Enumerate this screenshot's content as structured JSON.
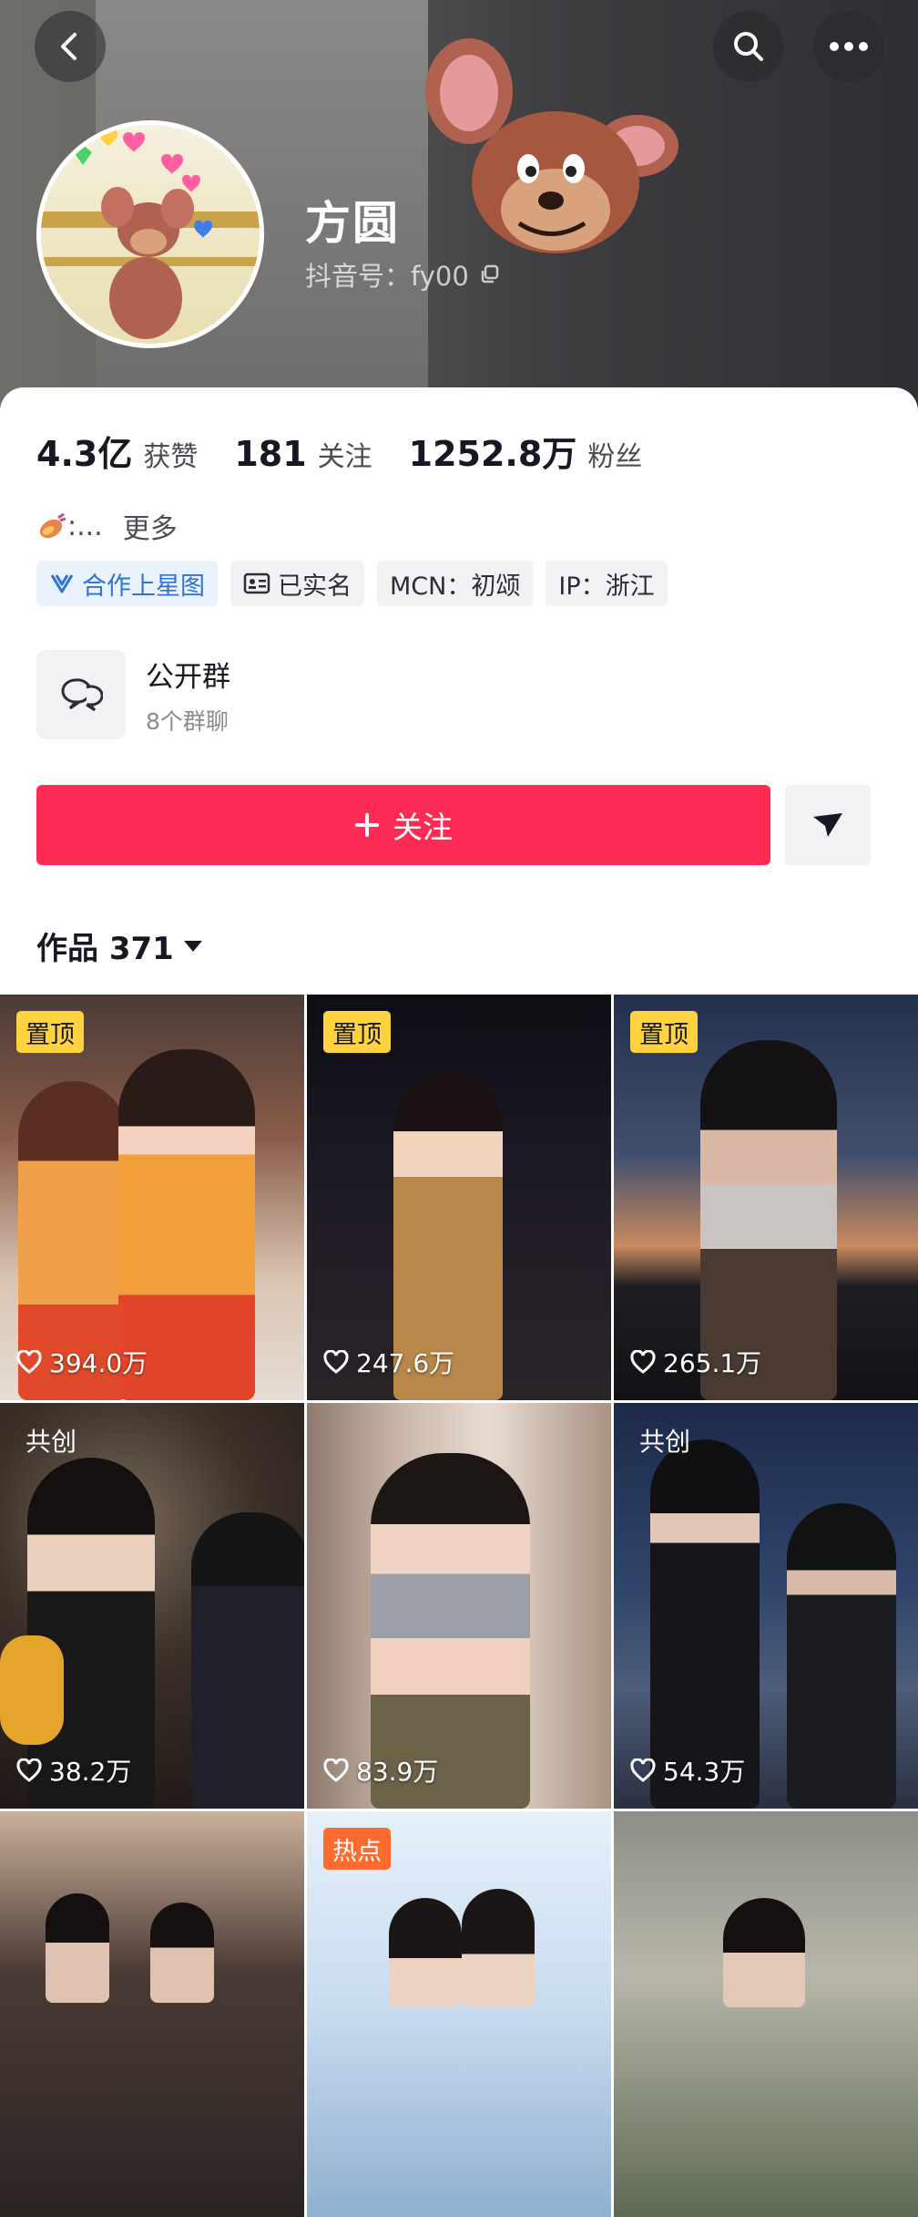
{
  "header": {
    "name": "方圆",
    "douyin_id": "抖音号：fy00"
  },
  "stats": [
    {
      "value": "4.3亿",
      "label": "获赞"
    },
    {
      "value": "181",
      "label": "关注"
    },
    {
      "value": "1252.8万",
      "label": "粉丝"
    }
  ],
  "bio": {
    "text": ":...",
    "more_label": "更多"
  },
  "tags": [
    {
      "label": "合作上星图",
      "icon": "star-map-icon"
    },
    {
      "label": "已实名",
      "icon": "id-card-icon"
    },
    {
      "label": "MCN：初颂",
      "icon": ""
    },
    {
      "label": "IP：浙江",
      "icon": ""
    }
  ],
  "group": {
    "title": "公开群",
    "subtitle": "8个群聊"
  },
  "actions": {
    "follow_label": "关注"
  },
  "works": {
    "label": "作品 371"
  },
  "tiles": [
    {
      "badge": "置顶",
      "likes": "394.0万"
    },
    {
      "badge": "置顶",
      "likes": "247.6万"
    },
    {
      "badge": "置顶",
      "likes": "265.1万"
    },
    {
      "badge": "共创",
      "likes": "38.2万"
    },
    {
      "badge": "",
      "likes": "83.9万"
    },
    {
      "badge": "共创",
      "likes": "54.3万"
    },
    {
      "badge": "",
      "likes": ""
    },
    {
      "badge": "热点",
      "likes": ""
    },
    {
      "badge": "",
      "likes": ""
    }
  ],
  "colors": {
    "accent": "#fe2c55",
    "pin_badge": "#ffd23f",
    "hot_badge": "#ff6a2e",
    "star_tag": "#2f74d0"
  }
}
